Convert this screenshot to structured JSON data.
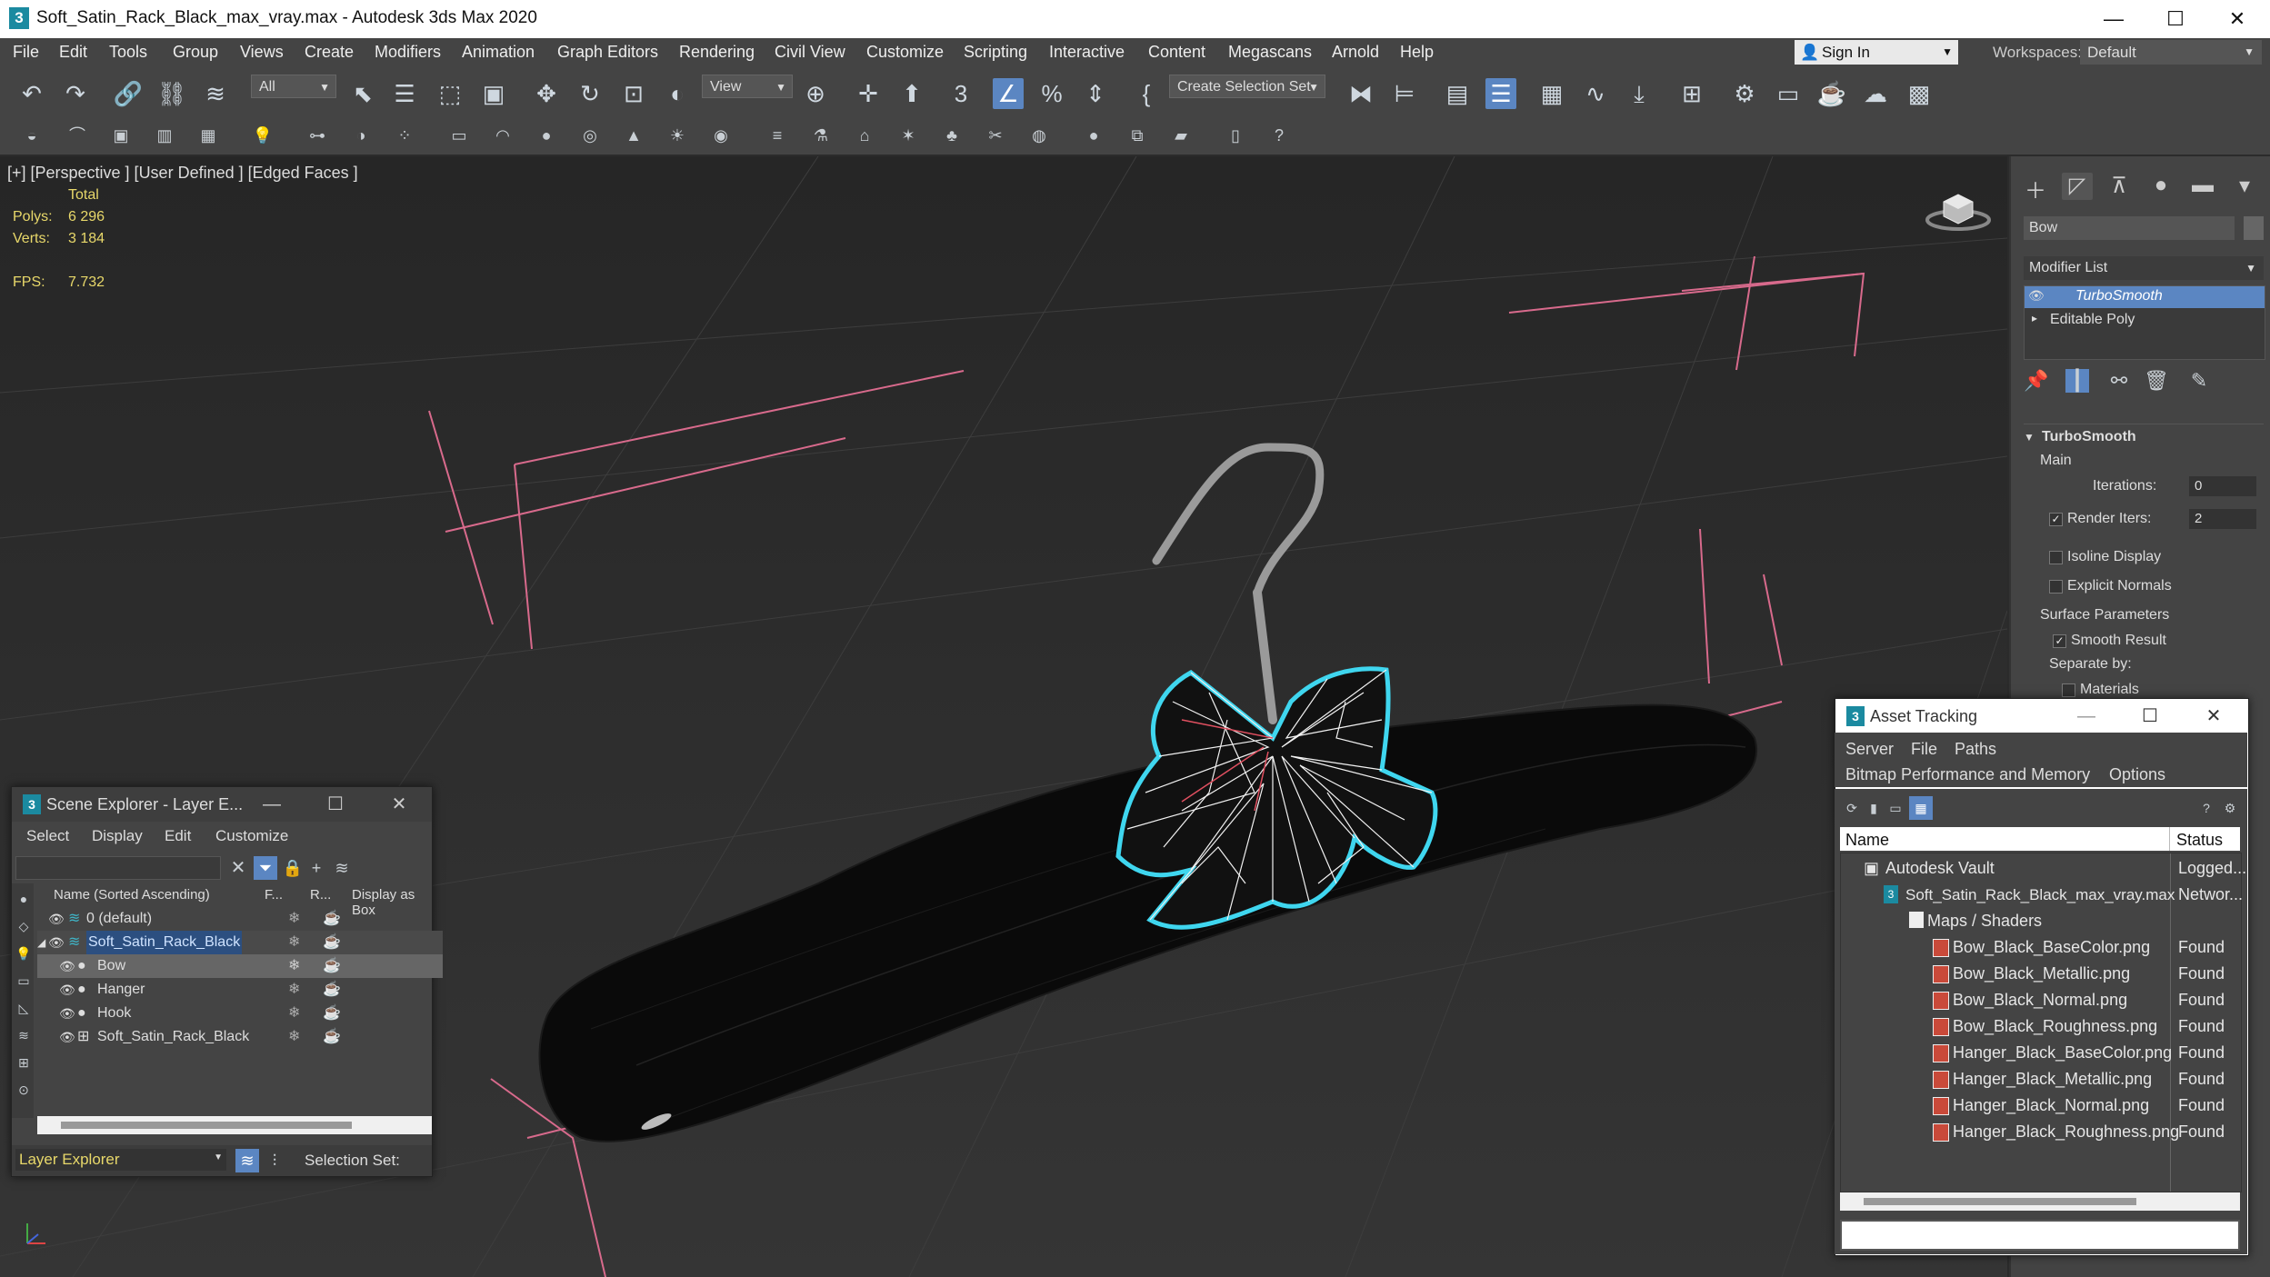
{
  "window": {
    "title": "Soft_Satin_Rack_Black_max_vray.max - Autodesk 3ds Max 2020",
    "app_icon": "3",
    "minimize": "—",
    "maximize": "☐",
    "close": "✕"
  },
  "menu": {
    "items": [
      "File",
      "Edit",
      "Tools",
      "Group",
      "Views",
      "Create",
      "Modifiers",
      "Animation",
      "Graph Editors",
      "Rendering",
      "Civil View",
      "Customize",
      "Scripting",
      "Interactive",
      "Content",
      "Megascans",
      "Arnold",
      "Help"
    ],
    "sign_in": "Sign In",
    "workspaces_label": "Workspaces:",
    "workspace_value": "Default"
  },
  "toolbar": {
    "selection_filter": "All",
    "reference_coord": "View",
    "create_selection_set": "Create Selection Set"
  },
  "viewport": {
    "label": "[+] [Perspective ] [User Defined ] [Edged Faces ]",
    "stats_header": "Total",
    "polys_label": "Polys:",
    "polys_value": "6 296",
    "verts_label": "Verts:",
    "verts_value": "3 184",
    "fps_label": "FPS:",
    "fps_value": "7.732"
  },
  "command_panel": {
    "object_name": "Bow",
    "modifier_list": "Modifier List",
    "stack": [
      "TurboSmooth",
      "Editable Poly"
    ],
    "rollout_title": "TurboSmooth",
    "main_label": "Main",
    "iterations_label": "Iterations:",
    "iterations_value": "0",
    "render_iters_label": "Render Iters:",
    "render_iters_value": "2",
    "isoline_display": "Isoline Display",
    "explicit_normals": "Explicit Normals",
    "surface_parameters": "Surface Parameters",
    "smooth_result": "Smooth Result",
    "separate_by": "Separate by:",
    "materials": "Materials"
  },
  "scene_explorer": {
    "title": "Scene Explorer - Layer E...",
    "menu": [
      "Select",
      "Display",
      "Edit",
      "Customize"
    ],
    "col_name": "Name (Sorted Ascending)",
    "col_f": "F...",
    "col_r": "R...",
    "col_display": "Display as Box",
    "rows": [
      "0 (default)",
      "Soft_Satin_Rack_Black",
      "Bow",
      "Hanger",
      "Hook",
      "Soft_Satin_Rack_Black"
    ],
    "footer_layer": "Layer Explorer",
    "footer_selection": "Selection Set:"
  },
  "asset_tracking": {
    "title": "Asset Tracking",
    "menu_row1": [
      "Server",
      "File",
      "Paths"
    ],
    "menu_row2": [
      "Bitmap Performance and Memory",
      "Options"
    ],
    "col_name": "Name",
    "col_status": "Status",
    "rows": [
      {
        "name": "Autodesk Vault",
        "status": "Logged..."
      },
      {
        "name": "Soft_Satin_Rack_Black_max_vray.max",
        "status": "Networ..."
      },
      {
        "name": "Maps / Shaders",
        "status": ""
      },
      {
        "name": "Bow_Black_BaseColor.png",
        "status": "Found"
      },
      {
        "name": "Bow_Black_Metallic.png",
        "status": "Found"
      },
      {
        "name": "Bow_Black_Normal.png",
        "status": "Found"
      },
      {
        "name": "Bow_Black_Roughness.png",
        "status": "Found"
      },
      {
        "name": "Hanger_Black_BaseColor.png",
        "status": "Found"
      },
      {
        "name": "Hanger_Black_Metallic.png",
        "status": "Found"
      },
      {
        "name": "Hanger_Black_Normal.png",
        "status": "Found"
      },
      {
        "name": "Hanger_Black_Roughness.png",
        "status": "Found"
      }
    ]
  },
  "colors": {
    "accent": "#5b86c2",
    "selection_highlight": "#3fd6ef",
    "stats_text": "#e8d86a",
    "gizmo_pink": "#d86a8c"
  }
}
